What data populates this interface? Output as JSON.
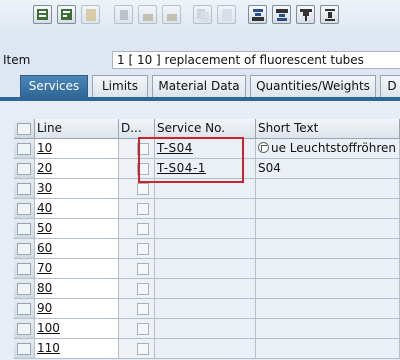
{
  "toolbar": {
    "buttons": [
      {
        "icon": "select-all-icon"
      },
      {
        "icon": "select-block-icon"
      },
      {
        "icon": "deselect-icon"
      },
      {
        "icon": "delete-icon"
      },
      {
        "icon": "lock-icon"
      },
      {
        "icon": "unlock-icon"
      },
      {
        "icon": "copy-icon"
      },
      {
        "icon": "insert-icon"
      },
      {
        "icon": "sort-ascending-icon"
      },
      {
        "icon": "sort-descending-icon"
      },
      {
        "icon": "filter-icon"
      },
      {
        "icon": "total-icon"
      }
    ]
  },
  "item": {
    "label": "Item",
    "value": "1 [ 10 ] replacement of fluorescent tubes"
  },
  "tabs": [
    {
      "label": "Services",
      "active": true
    },
    {
      "label": "Limits"
    },
    {
      "label": "Material Data"
    },
    {
      "label": "Quantities/Weights"
    },
    {
      "label": "D"
    }
  ],
  "table": {
    "headers": {
      "line": "Line",
      "d": "D...",
      "service": "Service No.",
      "text": "Short Text"
    },
    "rows": [
      {
        "line": "10",
        "service": "T-S04",
        "text": "ue Leuchtstoffröhren liefe"
      },
      {
        "line": "20",
        "service": "T-S04-1",
        "text": "S04"
      },
      {
        "line": "30",
        "service": "",
        "text": ""
      },
      {
        "line": "40",
        "service": "",
        "text": ""
      },
      {
        "line": "50",
        "service": "",
        "text": ""
      },
      {
        "line": "60",
        "service": "",
        "text": ""
      },
      {
        "line": "70",
        "service": "",
        "text": ""
      },
      {
        "line": "80",
        "service": "",
        "text": ""
      },
      {
        "line": "90",
        "service": "",
        "text": ""
      },
      {
        "line": "100",
        "service": "",
        "text": ""
      },
      {
        "line": "110",
        "service": "",
        "text": ""
      }
    ]
  },
  "colors": {
    "highlight": "#c8262c",
    "active_tab": "#2f6798"
  }
}
